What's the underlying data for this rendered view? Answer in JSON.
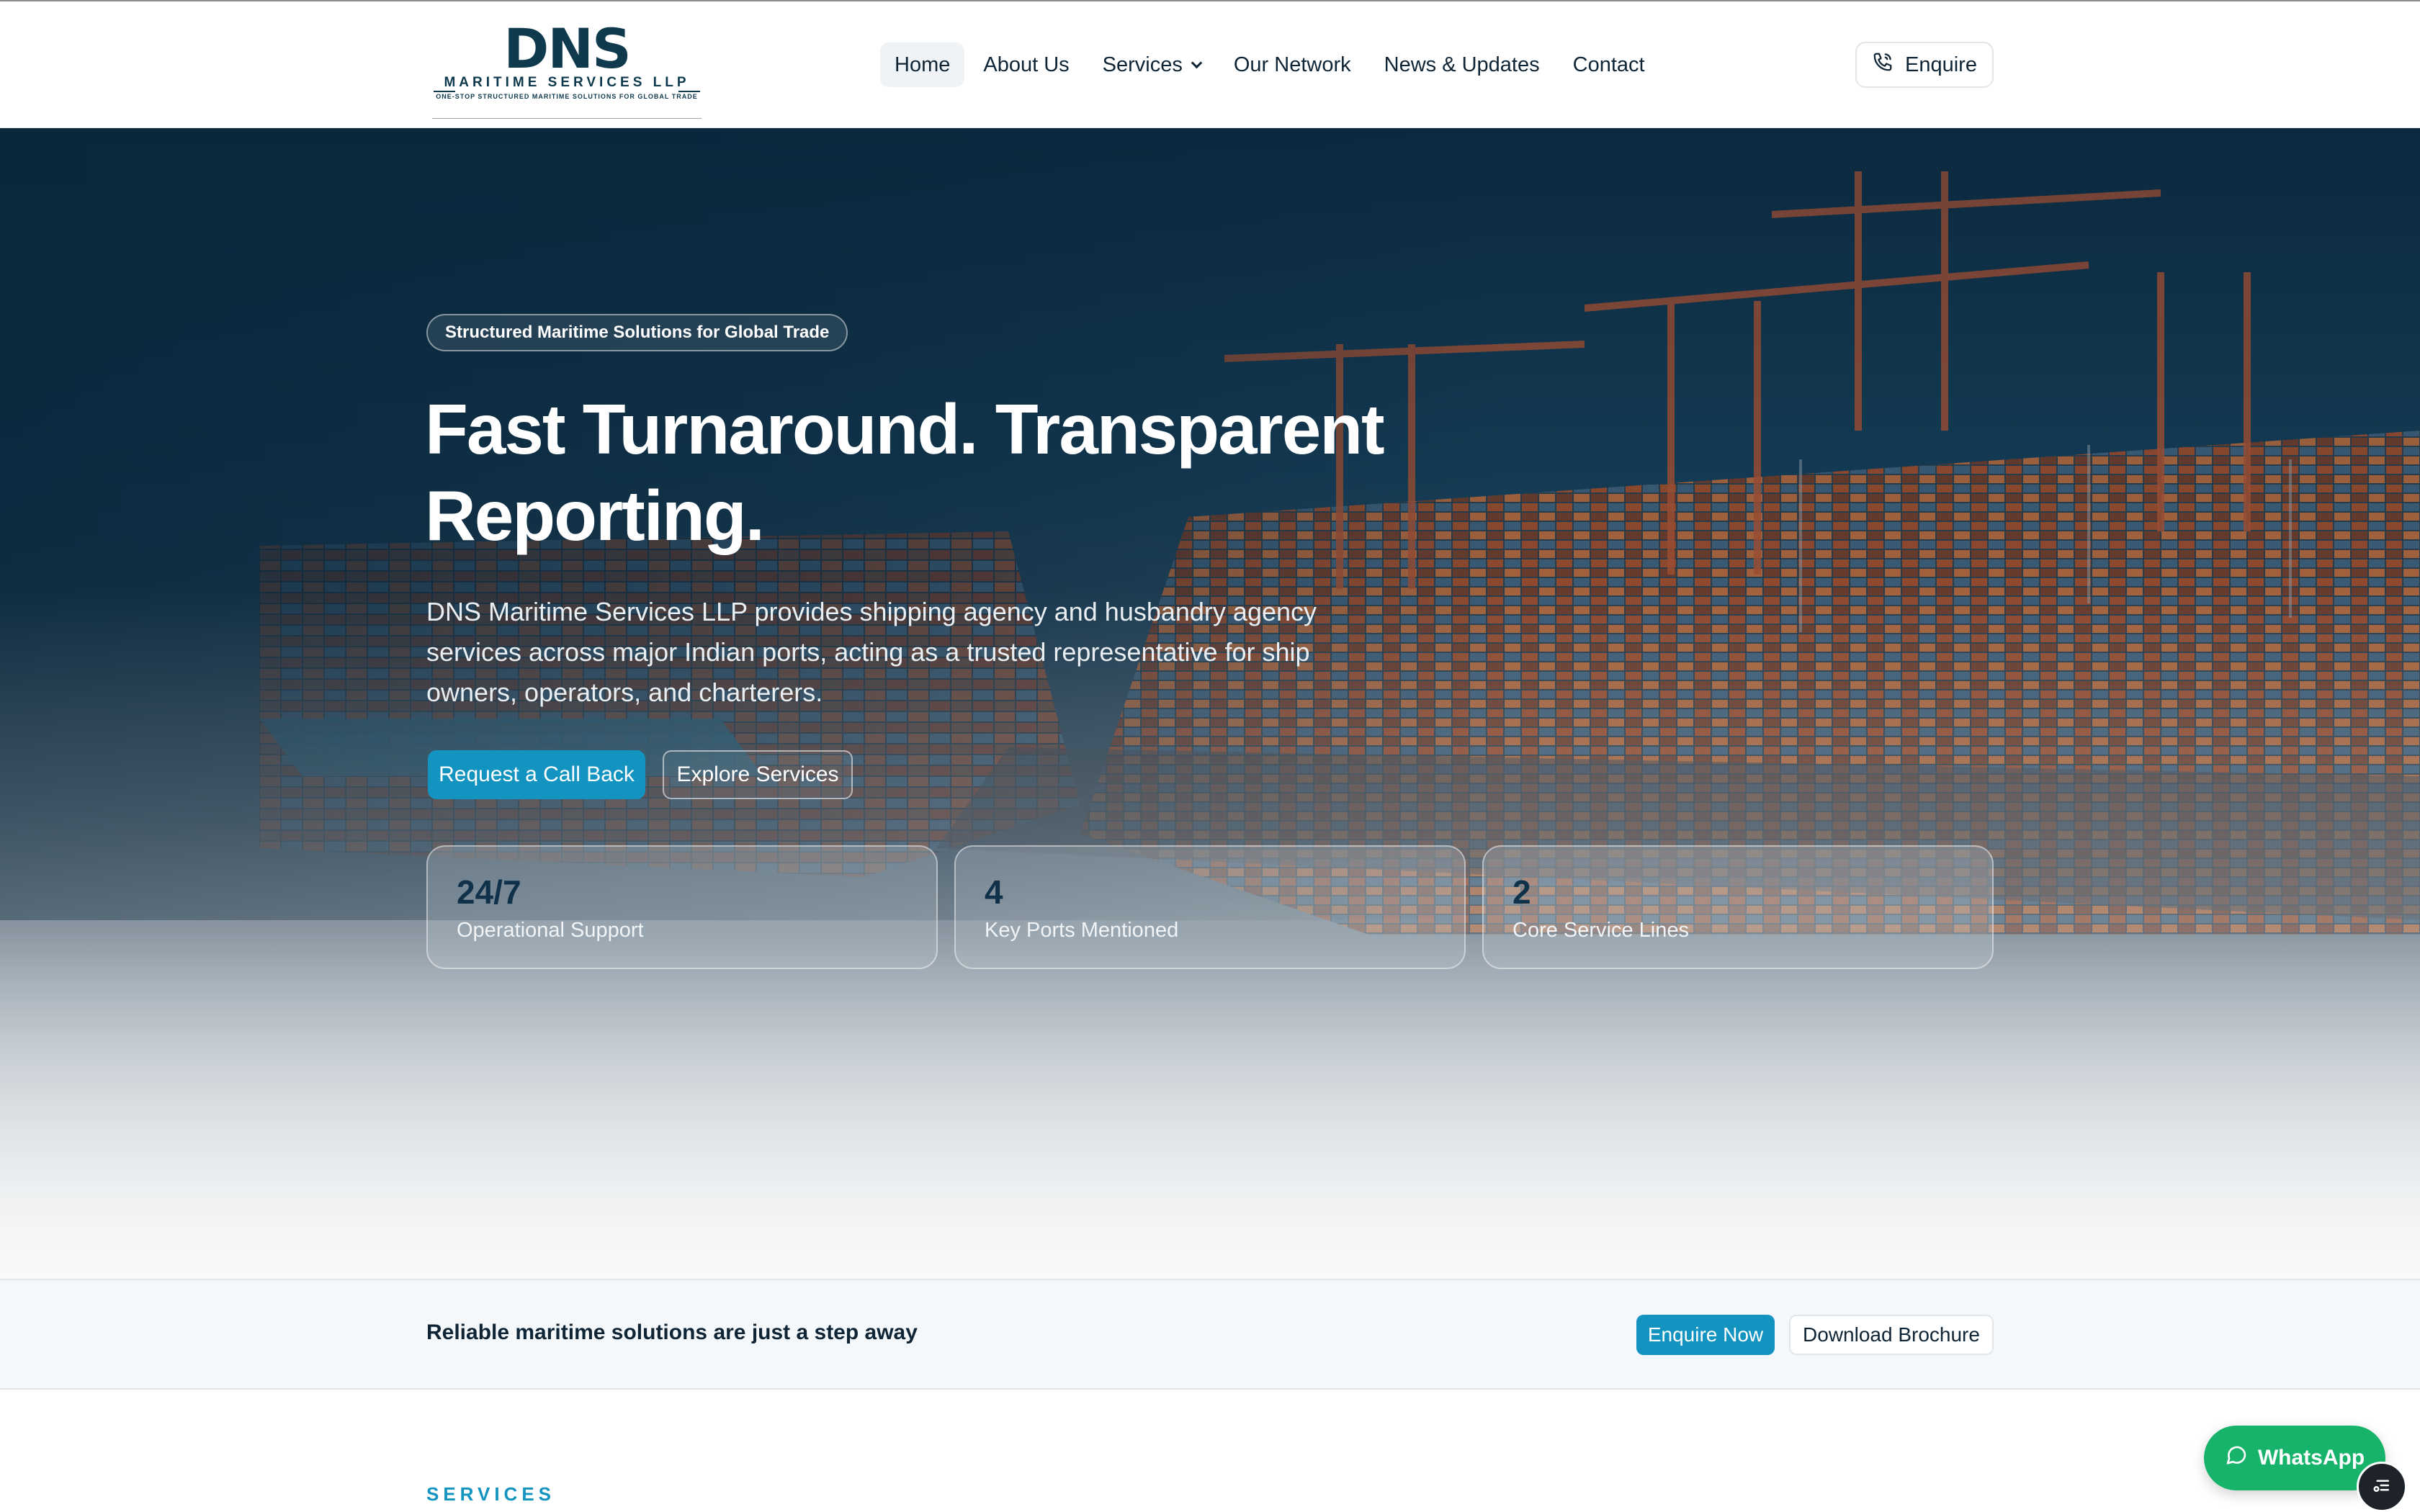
{
  "header": {
    "logo": {
      "mark": "DNS",
      "subtitle": "MARITIME SERVICES LLP",
      "tagline": "ONE-STOP STRUCTURED MARITIME SOLUTIONS FOR GLOBAL TRADE"
    },
    "nav": [
      {
        "label": "Home",
        "active": true
      },
      {
        "label": "About Us"
      },
      {
        "label": "Services",
        "has_dropdown": true
      },
      {
        "label": "Our Network"
      },
      {
        "label": "News & Updates"
      },
      {
        "label": "Contact"
      }
    ],
    "enquire_label": "Enquire",
    "enquire_icon": "phone-icon"
  },
  "hero": {
    "badge": "Structured Maritime Solutions for Global Trade",
    "title": "Fast Turnaround. Transparent Reporting.",
    "description": "DNS Maritime Services LLP provides shipping agency and husbandry agency services across major Indian ports, acting as a trusted representative for ship owners, operators, and charterers.",
    "primary_button": "Request a Call Back",
    "secondary_button": "Explore Services",
    "stats": [
      {
        "value": "24/7",
        "label": "Operational Support"
      },
      {
        "value": "4",
        "label": "Key Ports Mentioned"
      },
      {
        "value": "2",
        "label": "Core Service Lines"
      }
    ]
  },
  "cta": {
    "text": "Reliable maritime solutions are just a step away",
    "enquire_now": "Enquire Now",
    "download_brochure": "Download Brochure"
  },
  "services_section": {
    "eyebrow": "SERVICES"
  },
  "floating": {
    "whatsapp_label": "WhatsApp",
    "whatsapp_icon": "chat-bubble-icon",
    "widget_icon": "menu-widget-icon"
  },
  "colors": {
    "accent": "#1293c0",
    "navy": "#0f2536",
    "whatsapp": "#18b36b"
  }
}
